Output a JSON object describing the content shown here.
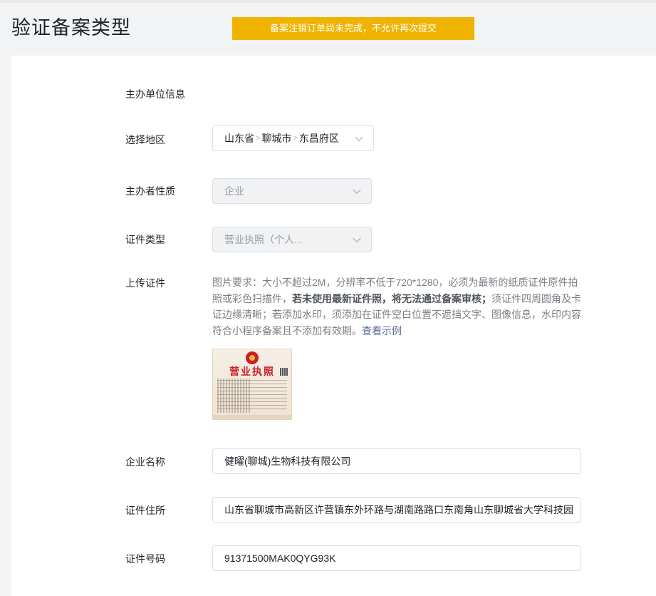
{
  "page": {
    "title": "验证备案类型"
  },
  "banner": {
    "text": "备案注销订单尚未完成，不允许再次提交"
  },
  "section": {
    "title": "主办单位信息"
  },
  "region": {
    "label": "选择地区",
    "province": "山东省",
    "city": "聊城市",
    "district": "东昌府区",
    "separator": ">"
  },
  "organizer": {
    "label": "主办者性质",
    "value": "企业"
  },
  "cert_type": {
    "label": "证件类型",
    "value": "营业执照（个人..."
  },
  "upload": {
    "label": "上传证件",
    "desc_part1": "图片要求：大小不超过2M，分辨率不低于720*1280，必须为最新的纸质证件原件拍照或彩色扫描件，",
    "desc_bold": "若未使用最新证件照，将无法通过备案审核；",
    "desc_part2": "须证件四周圆角及卡证边缘清晰；若添加水印，须添加在证件空白位置不遮挡文字、图像信息，水印内容符合小程序备案且不添加有效期。",
    "example_link": "查看示例",
    "thumbnail_title": "营业执照"
  },
  "company": {
    "label": "企业名称",
    "value": "健曜(聊城)生物科技有限公司"
  },
  "address": {
    "label": "证件住所",
    "value": "山东省聊城市高新区许营镇东外环路与湖南路路口东南角山东聊城省大学科技园"
  },
  "cert_no": {
    "label": "证件号码",
    "value": "91371500MAK0QYG93K"
  }
}
